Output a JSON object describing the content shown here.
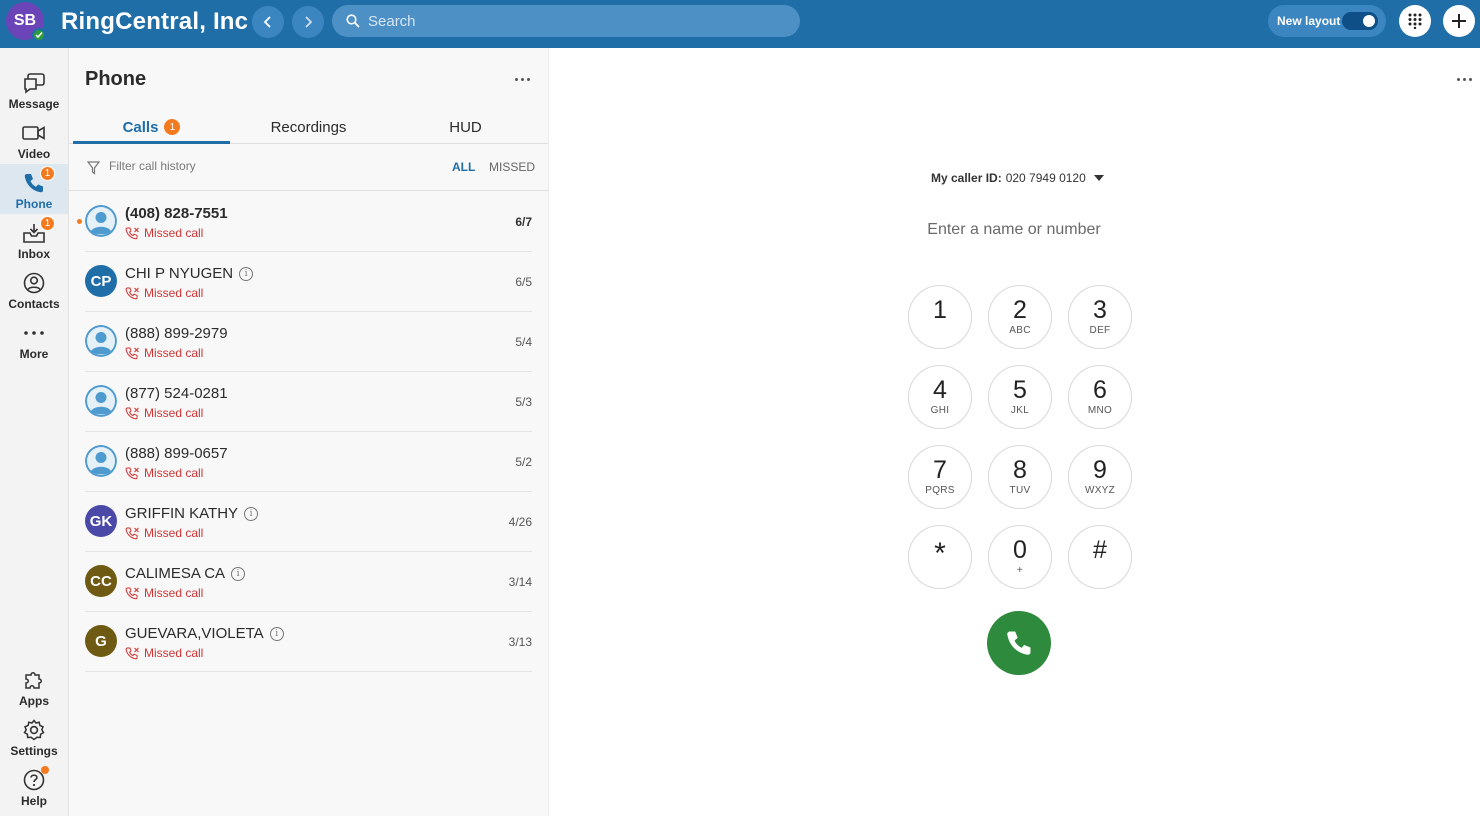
{
  "topbar": {
    "user_initials": "SB",
    "company": "RingCentral, Inc",
    "search_placeholder": "Search",
    "new_layout_label": "New layout"
  },
  "rail": {
    "items": [
      {
        "label": "Message",
        "icon": "message-icon"
      },
      {
        "label": "Video",
        "icon": "video-icon"
      },
      {
        "label": "Phone",
        "icon": "phone-icon",
        "badge": "1"
      },
      {
        "label": "Inbox",
        "icon": "inbox-icon",
        "badge": "1"
      },
      {
        "label": "Contacts",
        "icon": "contacts-icon"
      },
      {
        "label": "More",
        "icon": "more-icon"
      }
    ],
    "bottom": [
      {
        "label": "Apps",
        "icon": "apps-icon"
      },
      {
        "label": "Settings",
        "icon": "gear-icon"
      },
      {
        "label": "Help",
        "icon": "help-icon"
      }
    ]
  },
  "panel": {
    "title": "Phone",
    "tabs": [
      {
        "label": "Calls",
        "badge": "1"
      },
      {
        "label": "Recordings"
      },
      {
        "label": "HUD"
      }
    ],
    "filter_placeholder": "Filter call history",
    "filter_all": "ALL",
    "filter_missed": "MISSED"
  },
  "calls": [
    {
      "name": "(408) 828-7551",
      "status": "Missed call",
      "date": "6/7",
      "unread": true
    },
    {
      "name": "CHI P NYUGEN",
      "initials": "CP",
      "status": "Missed call",
      "date": "6/5"
    },
    {
      "name": "(888) 899-2979",
      "status": "Missed call",
      "date": "5/4"
    },
    {
      "name": "(877) 524-0281",
      "status": "Missed call",
      "date": "5/3"
    },
    {
      "name": "(888) 899-0657",
      "status": "Missed call",
      "date": "5/2"
    },
    {
      "name": "GRIFFIN KATHY",
      "initials": "GK",
      "status": "Missed call",
      "date": "4/26"
    },
    {
      "name": "CALIMESA CA",
      "initials": "CC",
      "status": "Missed call",
      "date": "3/14"
    },
    {
      "name": "GUEVARA,VIOLETA",
      "initials": "G",
      "status": "Missed call",
      "date": "3/13"
    }
  ],
  "dialer": {
    "caller_id_label": "My caller ID:",
    "caller_id_number": "020 7949 0120",
    "input_placeholder": "Enter a name or number",
    "keys": [
      {
        "digit": "1",
        "letters": ""
      },
      {
        "digit": "2",
        "letters": "ABC"
      },
      {
        "digit": "3",
        "letters": "DEF"
      },
      {
        "digit": "4",
        "letters": "GHI"
      },
      {
        "digit": "5",
        "letters": "JKL"
      },
      {
        "digit": "6",
        "letters": "MNO"
      },
      {
        "digit": "7",
        "letters": "PQRS"
      },
      {
        "digit": "8",
        "letters": "TUV"
      },
      {
        "digit": "9",
        "letters": "WXYZ"
      },
      {
        "digit": "*",
        "letters": ""
      },
      {
        "digit": "0",
        "letters": "+"
      },
      {
        "digit": "#",
        "letters": ""
      }
    ]
  },
  "colors": {
    "topbar": "#1f6ea8",
    "accent": "#1f6ea8",
    "badge": "#f47a20",
    "missed": "#d03434",
    "call_button": "#2e8a3c"
  }
}
